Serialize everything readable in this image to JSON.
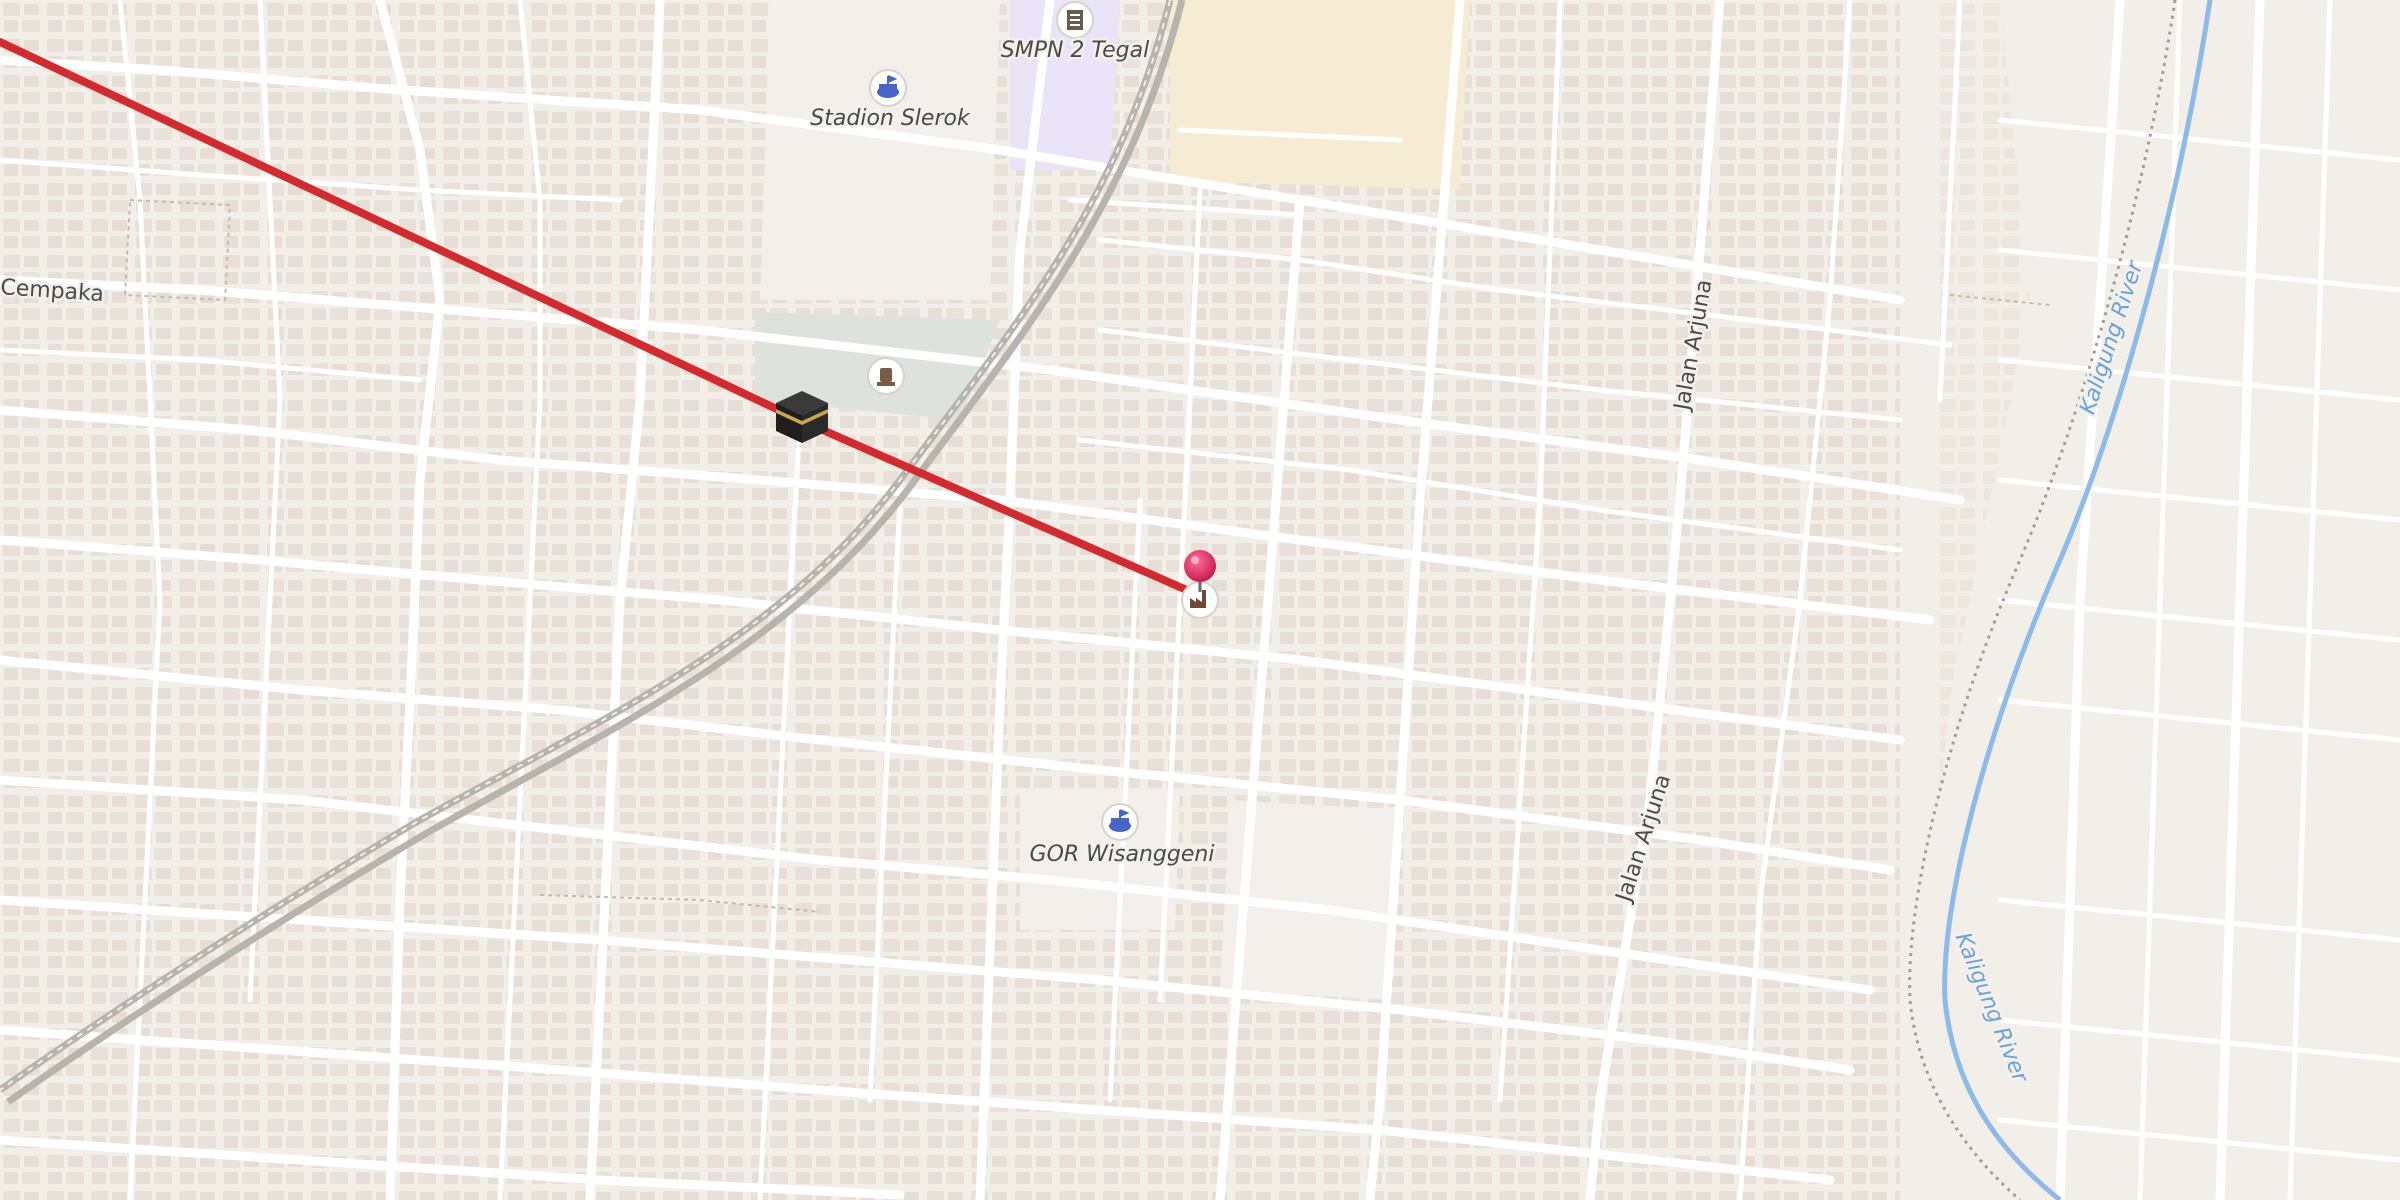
{
  "map": {
    "labels": {
      "smpn": "SMPN 2 Tegal",
      "stadion": "Stadion Slerok",
      "gor": "GOR Wisanggeni",
      "cempaka": "Cempaka",
      "arjuna_top": "Jalan Arjuna",
      "arjuna_bottom": "Jalan Arjuna",
      "river_top": "Kaligung River",
      "river_bottom": "Kaligung River"
    },
    "icons": {
      "school": "school-icon",
      "stadium": "stadium-icon",
      "sports_centre": "stadium-icon",
      "memorial": "memorial-icon",
      "kaaba": "kaaba-icon",
      "destination_marker": "pin-marker-icon",
      "factory": "factory-icon"
    },
    "colors": {
      "background": "#f2efe9",
      "building": "#e7dfd6",
      "road": "#ffffff",
      "rail": "#a9a6a1",
      "route_line": "#d42a2e",
      "pin": "#e0265c",
      "school_area": "#e9e4f7",
      "industrial_area": "#f6ecd3",
      "park": "#dde3dc",
      "water": "#8cbbe8"
    }
  }
}
